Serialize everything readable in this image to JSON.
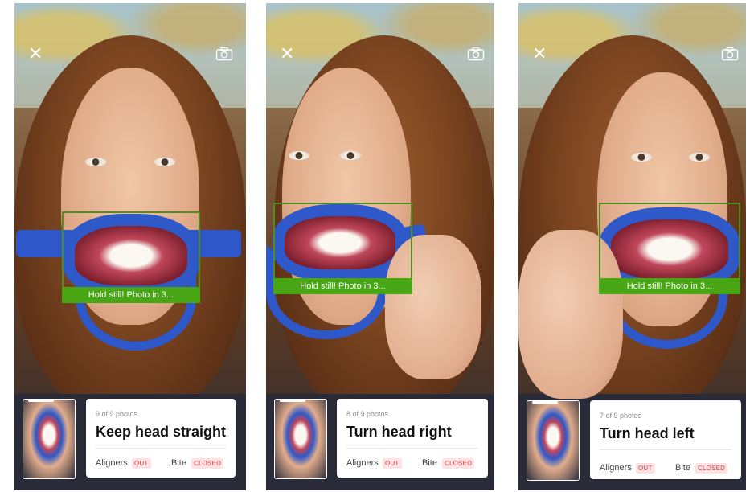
{
  "screens": [
    {
      "focus_message": "Hold still! Photo in 3...",
      "photo_count": "9 of 9 photos",
      "instruction": "Keep head straight",
      "aligners_label": "Aligners",
      "aligners_status": "OUT",
      "bite_label": "Bite",
      "bite_status": "CLOSED"
    },
    {
      "focus_message": "Hold still! Photo in 3...",
      "photo_count": "8 of 9 photos",
      "instruction": "Turn head right",
      "aligners_label": "Aligners",
      "aligners_status": "OUT",
      "bite_label": "Bite",
      "bite_status": "CLOSED"
    },
    {
      "focus_message": "Hold still! Photo in 3...",
      "photo_count": "7 of 9 photos",
      "instruction": "Turn head left",
      "aligners_label": "Aligners",
      "aligners_status": "OUT",
      "bite_label": "Bite",
      "bite_status": "CLOSED"
    }
  ],
  "icons": {
    "close": "close-icon",
    "camera": "camera-switch-icon"
  },
  "colors": {
    "focus_frame": "#4f8d21",
    "focus_bar": "#48a514",
    "badge_text": "#e0343a",
    "badge_bg": "#fde3e3",
    "retractor": "#2f58c8"
  }
}
